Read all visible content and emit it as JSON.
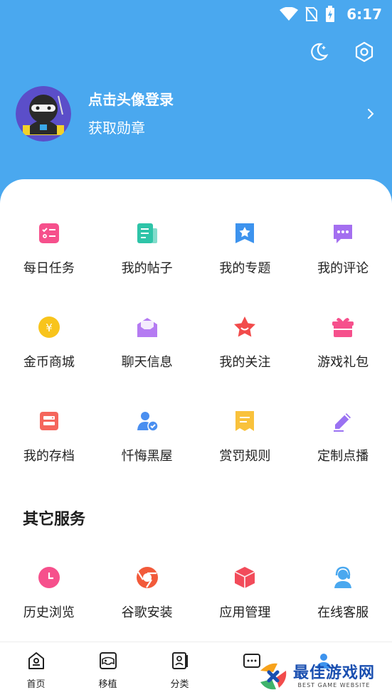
{
  "status": {
    "time": "6:17",
    "icons": [
      "wifi-icon",
      "no-sim-icon",
      "battery-charging-icon"
    ]
  },
  "header": {
    "icons": [
      "night-mode-icon",
      "settings-icon"
    ],
    "login_prompt": "点击头像登录",
    "badge_link": "获取勋章"
  },
  "menu": [
    {
      "label": "每日任务",
      "icon": "daily-task-icon",
      "color": "#f6508c"
    },
    {
      "label": "我的帖子",
      "icon": "my-posts-icon",
      "color": "#2ec4a8"
    },
    {
      "label": "我的专题",
      "icon": "my-topics-icon",
      "color": "#3d93ee"
    },
    {
      "label": "我的评论",
      "icon": "my-comments-icon",
      "color": "#a46ff0"
    },
    {
      "label": "金币商城",
      "icon": "coin-mall-icon",
      "color": "#f8c41c"
    },
    {
      "label": "聊天信息",
      "icon": "chat-message-icon",
      "color": "#b57bf2"
    },
    {
      "label": "我的关注",
      "icon": "my-follow-icon",
      "color": "#f24b4b"
    },
    {
      "label": "游戏礼包",
      "icon": "gift-pack-icon",
      "color": "#f6508c"
    },
    {
      "label": "我的存档",
      "icon": "save-archive-icon",
      "color": "#f5665c"
    },
    {
      "label": "忏悔黑屋",
      "icon": "confession-room-icon",
      "color": "#4a8ff0"
    },
    {
      "label": "赏罚规则",
      "icon": "rules-icon",
      "color": "#f9c23c"
    },
    {
      "label": "定制点播",
      "icon": "custom-request-icon",
      "color": "#9a72f2"
    }
  ],
  "other_services": {
    "title": "其它服务",
    "items": [
      {
        "label": "历史浏览",
        "icon": "history-icon",
        "color": "#f6508c"
      },
      {
        "label": "谷歌安装",
        "icon": "google-install-icon",
        "color": "#f25a3a"
      },
      {
        "label": "应用管理",
        "icon": "app-manage-icon",
        "color": "#f24b5a"
      },
      {
        "label": "在线客服",
        "icon": "customer-service-icon",
        "color": "#4aa8ef"
      }
    ]
  },
  "bottom_nav": [
    {
      "label": "首页",
      "icon": "home-icon"
    },
    {
      "label": "移植",
      "icon": "gamepad-icon"
    },
    {
      "label": "分类",
      "icon": "category-icon"
    },
    {
      "label": "",
      "icon": "community-icon"
    },
    {
      "label": "",
      "icon": "profile-icon"
    }
  ],
  "watermark": {
    "main": "最佳游戏网",
    "sub": "BEST GAME WEBSITE"
  },
  "colors": {
    "header_bg": "#4aa8ef",
    "accent": "#3d93ee"
  }
}
